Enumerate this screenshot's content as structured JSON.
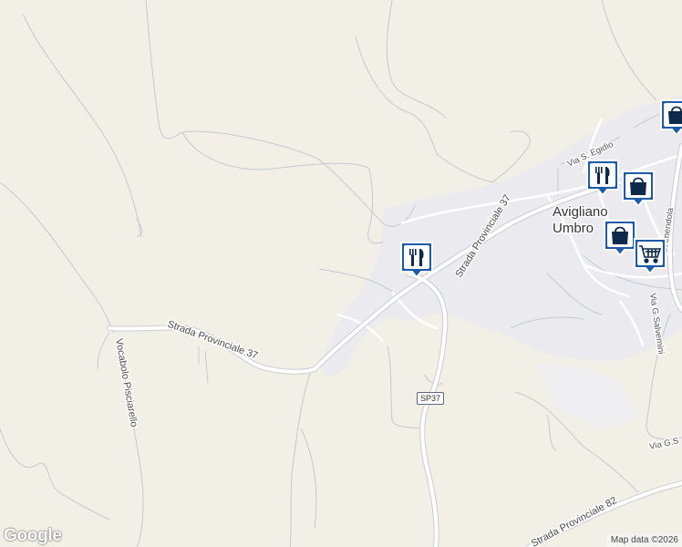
{
  "map": {
    "town_line1": "Avigliano",
    "town_line2": "Umbro",
    "road_labels": {
      "sp37_west": "Strada Provinciale 37",
      "sp37_east": "Strada Provinciale 37",
      "vocabolo": "Vocabolo Pisciarello",
      "sp82": "Strada Provinciale 82",
      "via_egidio": "Via S. Egidio",
      "via_salvemini": "Via G.Salvemini",
      "via_gs": "Via G.S",
      "via_amendola": "ia Amendola"
    },
    "route_shield": "SP37",
    "logo_text": "Google",
    "attribution": "Map data ©2026"
  },
  "colors": {
    "land": "#f2efe6",
    "urban": "#eaeaee",
    "road": "#ffffff",
    "road_edge": "#c9ccd4",
    "marker_blue": "#1e5aa8",
    "marker_dark": "#0e2a4a"
  },
  "markers": [
    {
      "name": "restaurant-marker",
      "icon": "fork-knife-icon"
    },
    {
      "name": "restaurant-marker",
      "icon": "fork-knife-icon"
    },
    {
      "name": "shopping-marker",
      "icon": "shopping-bag-icon"
    },
    {
      "name": "shopping-marker",
      "icon": "shopping-bag-icon"
    },
    {
      "name": "shopping-marker",
      "icon": "shopping-bag-icon"
    },
    {
      "name": "grocery-marker",
      "icon": "shopping-cart-icon"
    }
  ]
}
